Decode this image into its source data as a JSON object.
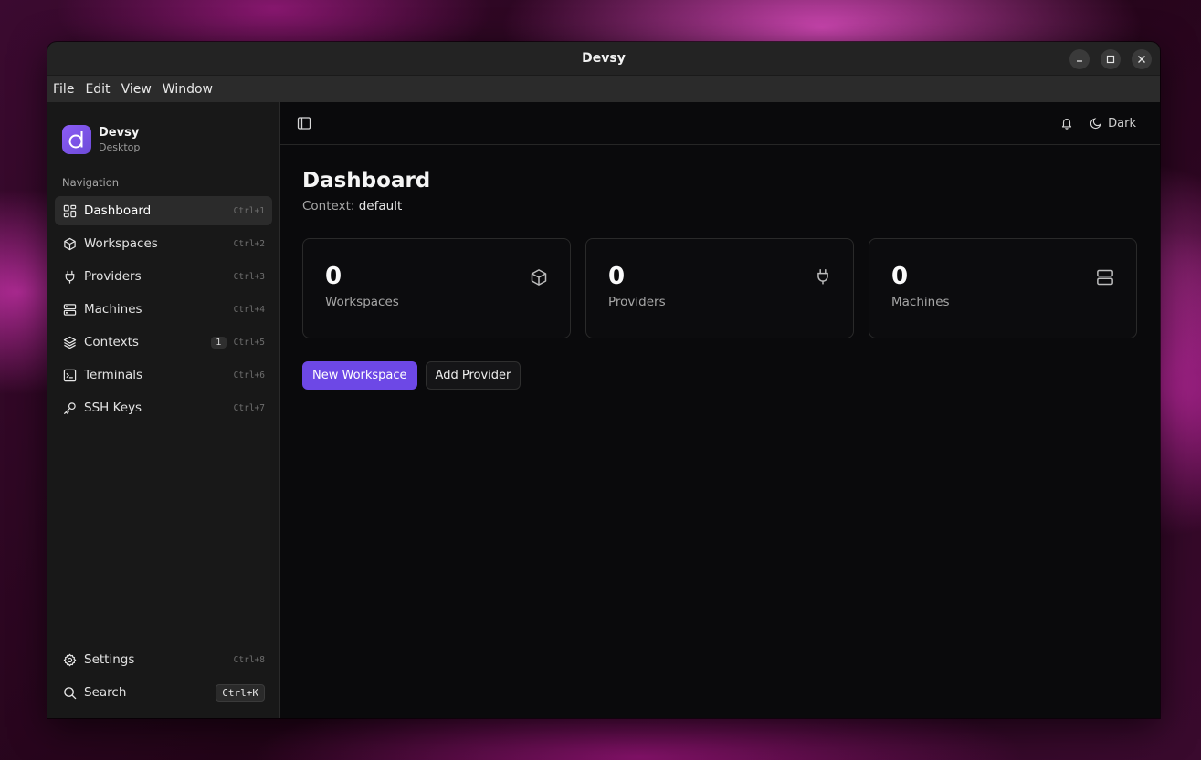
{
  "window": {
    "title": "Devsy"
  },
  "menu": [
    "File",
    "Edit",
    "View",
    "Window"
  ],
  "brand": {
    "name": "Devsy",
    "subtitle": "Desktop",
    "logo_letter": "d",
    "accent": "#7c5cf0"
  },
  "sidebar": {
    "heading": "Navigation",
    "items": [
      {
        "label": "Dashboard",
        "shortcut": "Ctrl+1",
        "icon": "dashboard-icon",
        "active": true
      },
      {
        "label": "Workspaces",
        "shortcut": "Ctrl+2",
        "icon": "cube-icon"
      },
      {
        "label": "Providers",
        "shortcut": "Ctrl+3",
        "icon": "plug-icon"
      },
      {
        "label": "Machines",
        "shortcut": "Ctrl+4",
        "icon": "server-icon"
      },
      {
        "label": "Contexts",
        "shortcut": "Ctrl+5",
        "icon": "layers-icon",
        "badge": "1"
      },
      {
        "label": "Terminals",
        "shortcut": "Ctrl+6",
        "icon": "terminal-icon"
      },
      {
        "label": "SSH Keys",
        "shortcut": "Ctrl+7",
        "icon": "key-icon"
      }
    ],
    "bottom": [
      {
        "label": "Settings",
        "shortcut": "Ctrl+8",
        "icon": "gear-icon"
      },
      {
        "label": "Search",
        "shortcut": "Ctrl+K",
        "icon": "search-icon"
      }
    ]
  },
  "topbar": {
    "theme_label": "Dark"
  },
  "page": {
    "title": "Dashboard",
    "context_label": "Context:",
    "context_value": "default"
  },
  "stats": [
    {
      "value": "0",
      "label": "Workspaces",
      "icon": "cube-icon"
    },
    {
      "value": "0",
      "label": "Providers",
      "icon": "plug-icon"
    },
    {
      "value": "0",
      "label": "Machines",
      "icon": "server-icon"
    }
  ],
  "actions": {
    "primary": "New Workspace",
    "secondary": "Add Provider"
  }
}
